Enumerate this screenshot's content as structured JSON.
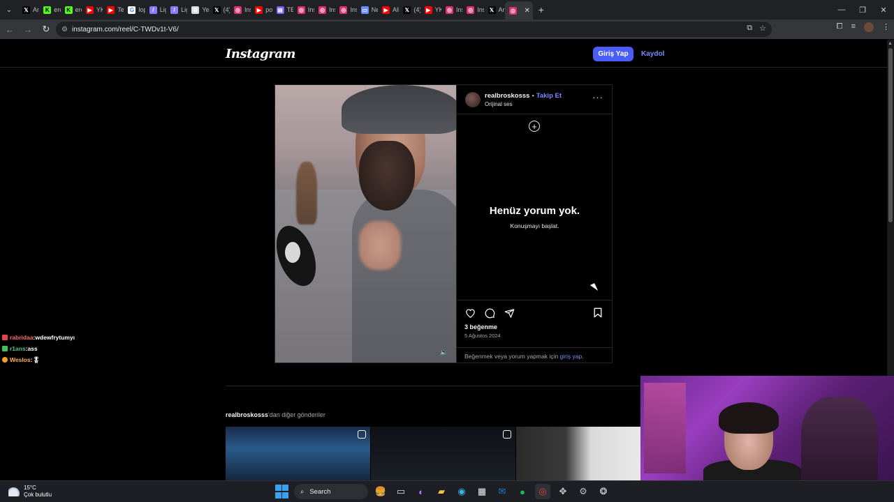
{
  "browser": {
    "tabs": [
      {
        "label": "Ana",
        "icon": "x-icon",
        "color": "#000000"
      },
      {
        "label": "eren",
        "icon": "kick-icon",
        "color": "#53fc18"
      },
      {
        "label": "eren",
        "icon": "kick-icon",
        "color": "#53fc18"
      },
      {
        "label": "YKK",
        "icon": "youtube-icon",
        "color": "#ff0000"
      },
      {
        "label": "Teo",
        "icon": "youtube-icon",
        "color": "#ff0000"
      },
      {
        "label": "lopr",
        "icon": "google-icon",
        "color": "#ffffff"
      },
      {
        "label": "Ligh",
        "icon": "feather-icon",
        "color": "#8a7cff"
      },
      {
        "label": "Ligh",
        "icon": "feather-icon",
        "color": "#8a7cff"
      },
      {
        "label": "Yen",
        "icon": "chatgpt-icon",
        "color": "#dddddd"
      },
      {
        "label": "(4)",
        "icon": "x-icon",
        "color": "#000000"
      },
      {
        "label": "Inst",
        "icon": "instagram-icon",
        "color": "#e1306c"
      },
      {
        "label": "poğ",
        "icon": "youtube-icon",
        "color": "#ff0000"
      },
      {
        "label": "TER",
        "icon": "doc-icon",
        "color": "#7a5cff"
      },
      {
        "label": "Inst",
        "icon": "instagram-icon",
        "color": "#e1306c"
      },
      {
        "label": "Inst",
        "icon": "instagram-icon",
        "color": "#e1306c"
      },
      {
        "label": "Inst",
        "icon": "instagram-icon",
        "color": "#e1306c"
      },
      {
        "label": "Nea",
        "icon": "monitor-icon",
        "color": "#6b8cff"
      },
      {
        "label": "Alb",
        "icon": "youtube-icon",
        "color": "#ff0000"
      },
      {
        "label": "(4)",
        "icon": "x-icon",
        "color": "#000000"
      },
      {
        "label": "YKK",
        "icon": "youtube-icon",
        "color": "#ff0000"
      },
      {
        "label": "Inst",
        "icon": "instagram-icon",
        "color": "#e1306c"
      },
      {
        "label": "Inst",
        "icon": "instagram-icon",
        "color": "#e1306c"
      },
      {
        "label": "Ana",
        "icon": "x-icon",
        "color": "#000000"
      }
    ],
    "url": "instagram.com/reel/C-TWDv1t-V6/"
  },
  "instagram": {
    "logo": "Instagram",
    "login_label": "Giriş Yap",
    "signup_label": "Kaydol"
  },
  "post": {
    "username": "realbroskosss",
    "separator": "•",
    "follow_label": "Takip Et",
    "audio_label": "Orijinal ses",
    "empty_title": "Henüz yorum yok.",
    "empty_subtitle": "Konuşmayı başlat.",
    "likes": "3 beğenme",
    "date": "5 Ağustos 2024",
    "login_prompt_prefix": "Beğenmek veya yorum yapmak için ",
    "login_prompt_link": "giriş yap",
    "login_prompt_suffix": "."
  },
  "more_posts": {
    "username": "realbroskosss",
    "suffix": "'dan diğer gönderiler"
  },
  "chat": [
    {
      "user": "rabridaa",
      "message": "wdewfrytumyı",
      "color": "#ff6b6b",
      "badge": "heart"
    },
    {
      "user": "r1ans",
      "message": "ass",
      "color": "#4ecb71",
      "badge": "sword"
    },
    {
      "user": "Weslos",
      "message": "🎖",
      "color": "#ffb347",
      "badge": "coin"
    }
  ],
  "taskbar": {
    "temperature": "15°C",
    "weather": "Çok bulutlu",
    "search_label": "Search"
  }
}
